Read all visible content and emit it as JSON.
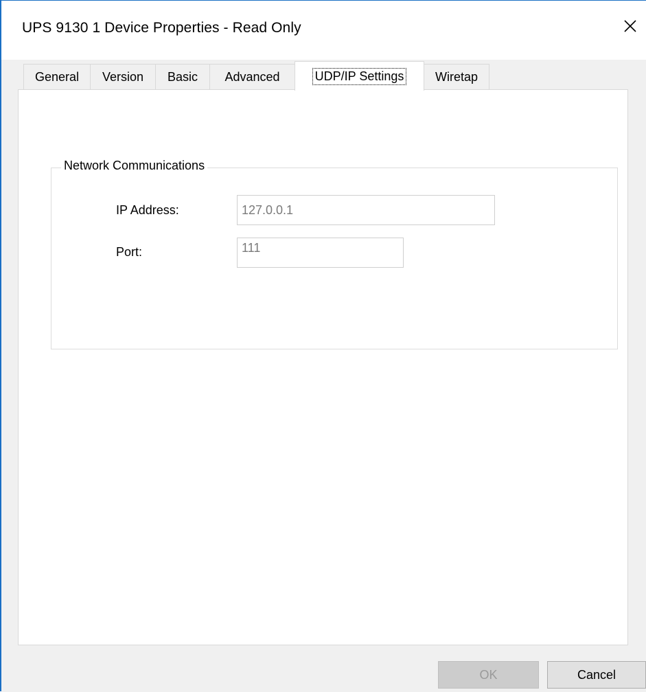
{
  "window": {
    "title": "UPS 9130 1 Device Properties - Read Only",
    "close_icon": "close-icon",
    "accent_color": "#1a6fc4"
  },
  "tabs": [
    {
      "label": "General",
      "active": false
    },
    {
      "label": "Version",
      "active": false
    },
    {
      "label": "Basic",
      "active": false
    },
    {
      "label": "Advanced",
      "active": false
    },
    {
      "label": "UDP/IP Settings",
      "active": true
    },
    {
      "label": "Wiretap",
      "active": false
    }
  ],
  "network": {
    "group_label": "Network Communications",
    "ip_label": "IP Address:",
    "ip_value": "127.0.0.1",
    "port_label": "Port:",
    "port_value": "111"
  },
  "buttons": {
    "ok": "OK",
    "cancel": "Cancel"
  }
}
